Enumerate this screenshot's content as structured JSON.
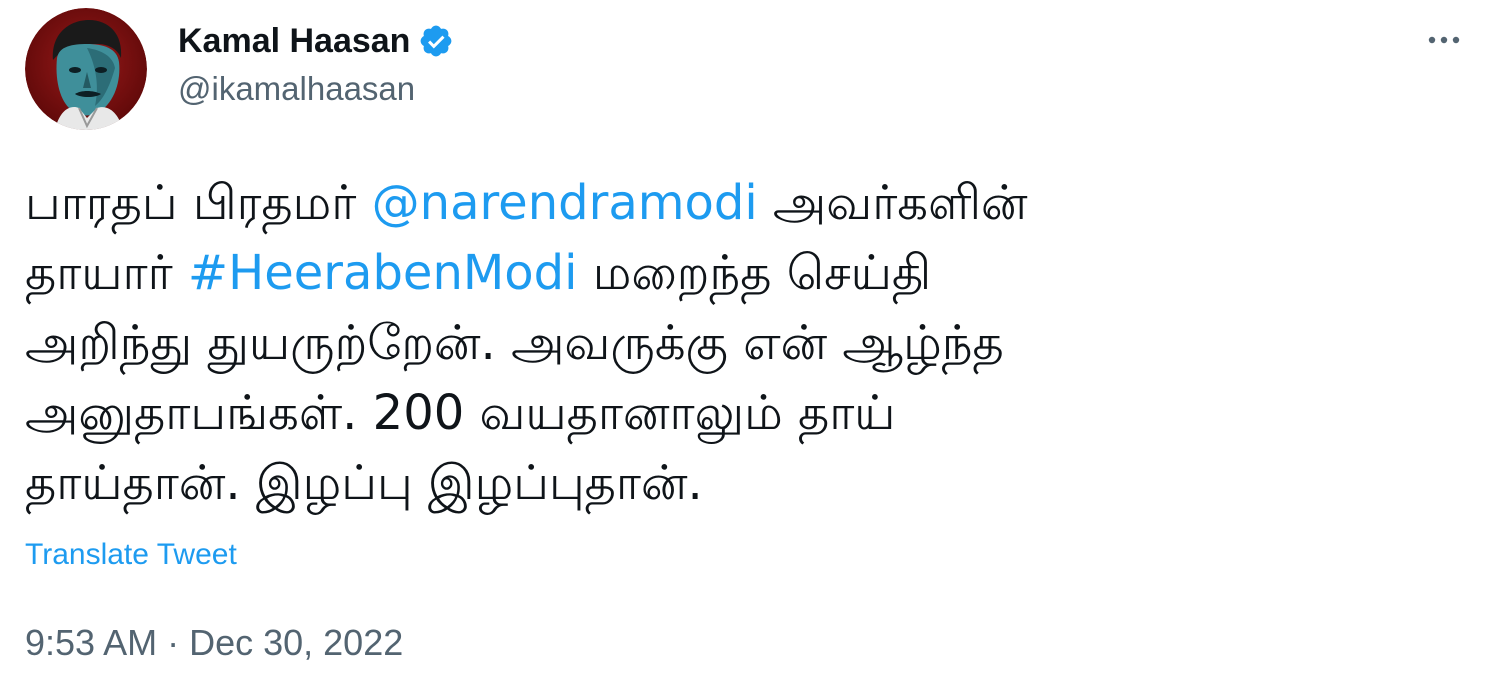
{
  "author": {
    "display_name": "Kamal Haasan",
    "handle": "@ikamalhaasan",
    "verified_icon": "verified-badge-icon",
    "avatar_icon": "avatar"
  },
  "more_icon": "more-horizontal-icon",
  "tweet": {
    "line1_a": "பாரதப் பிரதமர் ",
    "mention": "@narendramodi",
    "line1_b": " அவர்களின்",
    "line2_a": "தாயார் ",
    "hashtag": "#HeerabenModi",
    "line2_b": " மறைந்த செய்தி",
    "line3": "அறிந்து துயருற்றேன். அவருக்கு என் ஆழ்ந்த",
    "line4": "அனுதாபங்கள். 200 வயதானாலும் தாய்",
    "line5": "தாய்தான். இழப்பு இழப்புதான்."
  },
  "translate_label": "Translate Tweet",
  "timestamp": {
    "time": "9:53 AM",
    "separator": " · ",
    "date": "Dec 30, 2022"
  },
  "colors": {
    "link": "#1d9bf0",
    "secondary_text": "#536471",
    "primary_text": "#0f1419",
    "avatar_bg": "#7a0d0d"
  }
}
